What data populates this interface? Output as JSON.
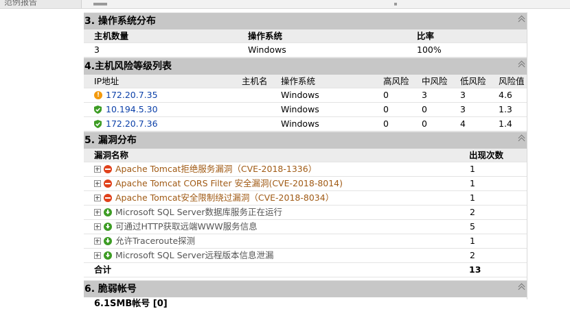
{
  "tab": {
    "title": "范例报告"
  },
  "section3": {
    "title": "3. 操作系统分布",
    "headers": {
      "count": "主机数量",
      "os": "操作系统",
      "ratio": "比率"
    },
    "rows": [
      {
        "count": "3",
        "os": "Windows",
        "ratio": "100%"
      }
    ]
  },
  "section4": {
    "title": "4.主机风险等级列表",
    "headers": {
      "ip": "IP地址",
      "host": "主机名",
      "os": "操作系统",
      "high": "高风险",
      "mid": "中风险",
      "low": "低风险",
      "score": "风险值"
    },
    "rows": [
      {
        "ip": "172.20.7.35",
        "os": "Windows",
        "high": "0",
        "mid": "3",
        "low": "3",
        "score": "4.6",
        "icon": "warning-icon"
      },
      {
        "ip": "10.194.5.30",
        "os": "Windows",
        "high": "0",
        "mid": "0",
        "low": "3",
        "score": "1.3",
        "icon": "shield-check-icon"
      },
      {
        "ip": "172.20.7.36",
        "os": "Windows",
        "high": "0",
        "mid": "0",
        "low": "4",
        "score": "1.4",
        "icon": "shield-check-icon"
      }
    ]
  },
  "section5": {
    "title": "5. 漏洞分布",
    "headers": {
      "name": "漏洞名称",
      "count": "出现次数"
    },
    "rows": [
      {
        "name": "Apache Tomcat拒绝服务漏洞（CVE-2018-1336）",
        "count": "1",
        "level": "high"
      },
      {
        "name": "Apache Tomcat CORS Filter 安全漏洞(CVE-2018-8014)",
        "count": "1",
        "level": "high"
      },
      {
        "name": "Apache Tomcat安全限制绕过漏洞（CVE-2018-8034）",
        "count": "1",
        "level": "high"
      },
      {
        "name": "Microsoft SQL Server数据库服务正在运行",
        "count": "2",
        "level": "low"
      },
      {
        "name": "可通过HTTP获取远端WWW服务信息",
        "count": "5",
        "level": "low"
      },
      {
        "name": "允许Traceroute探测",
        "count": "1",
        "level": "low"
      },
      {
        "name": "Microsoft SQL Server远程版本信息泄漏",
        "count": "2",
        "level": "low"
      }
    ],
    "total_label": "合计",
    "total_value": "13"
  },
  "section6": {
    "title": "6. 脆弱帐号",
    "subtitle": "6.1SMB帐号 [0]"
  },
  "colors": {
    "header_bg": "#c7c7c7",
    "subheader_bg": "#ececec",
    "high_link": "#a05a14",
    "low_link": "#555555",
    "warn": "#f39a0e",
    "ok": "#3d9c24",
    "danger": "#e0421c"
  }
}
